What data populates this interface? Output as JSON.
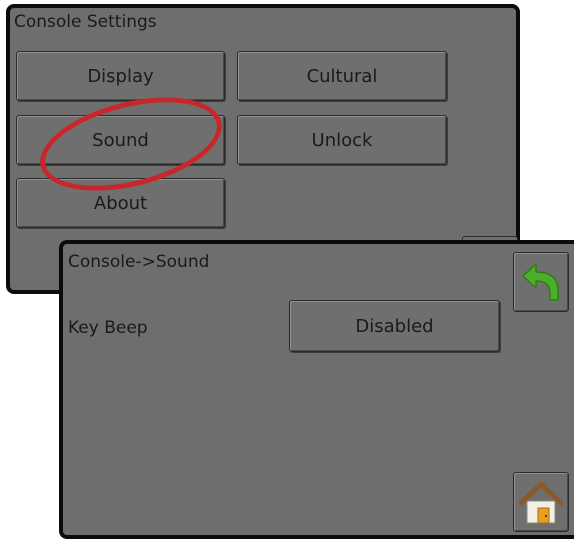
{
  "console_settings": {
    "title": "Console Settings",
    "buttons": {
      "display": "Display",
      "cultural": "Cultural",
      "sound": "Sound",
      "unlock": "Unlock",
      "about": "About"
    },
    "highlight_color": "#c8262b"
  },
  "sound_screen": {
    "title": "Console->Sound",
    "key_beep": {
      "label": "Key Beep",
      "value": "Disabled"
    },
    "icons": {
      "back": "back-arrow-icon",
      "home": "home-icon"
    },
    "colors": {
      "back_arrow": "#4caf2a",
      "home_roof": "#8a5a2b",
      "home_door": "#e8a020"
    }
  }
}
